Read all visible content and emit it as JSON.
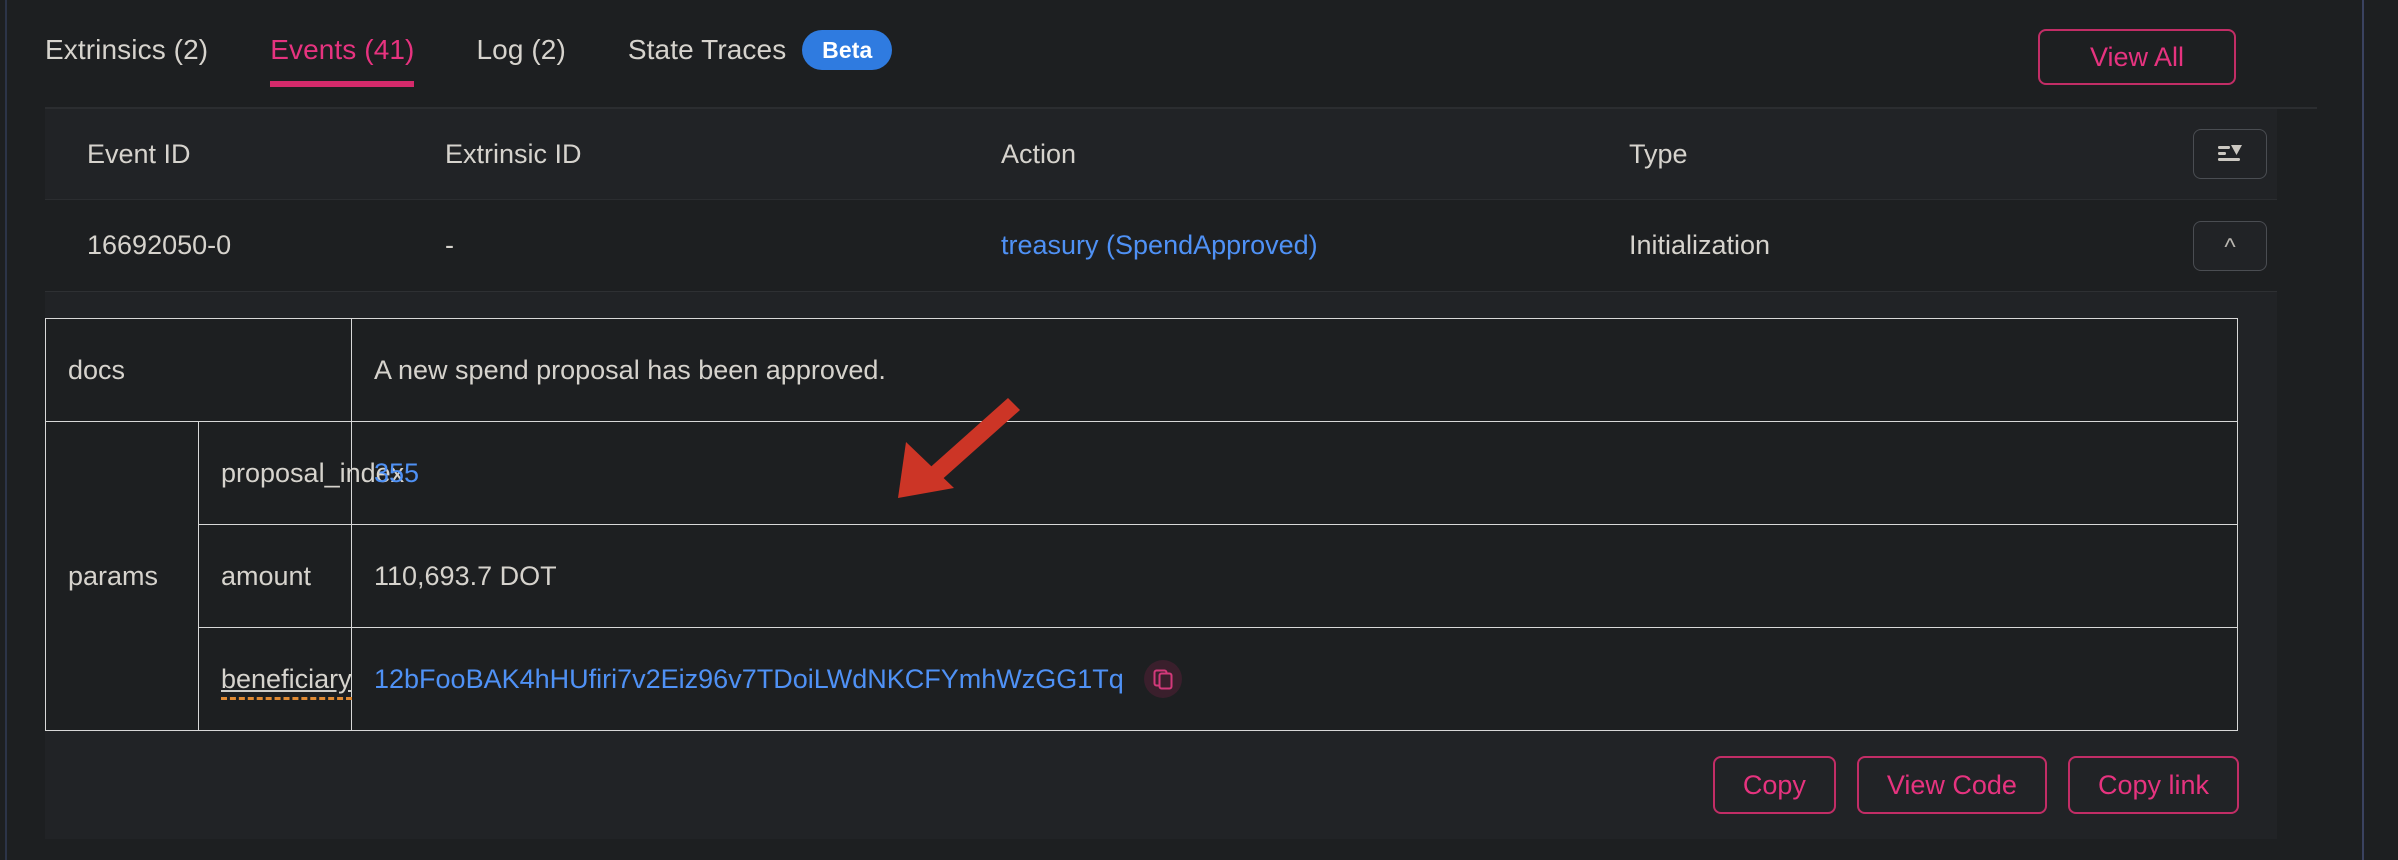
{
  "tabs": [
    {
      "label": "Extrinsics (2)",
      "active": false,
      "badge": null
    },
    {
      "label": "Events (41)",
      "active": true,
      "badge": null
    },
    {
      "label": "Log (2)",
      "active": false,
      "badge": null
    },
    {
      "label": "State Traces",
      "active": false,
      "badge": "Beta"
    }
  ],
  "header": {
    "view_all_label": "View All"
  },
  "table": {
    "columns": [
      "Event ID",
      "Extrinsic ID",
      "Action",
      "Type"
    ],
    "filter_icon": "sort-filter-icon",
    "rows": [
      {
        "event_id": "16692050-0",
        "extrinsic_id": "-",
        "action": "treasury (SpendApproved)",
        "type": "Initialization",
        "expand_icon": "chevron-up-icon"
      }
    ]
  },
  "detail": {
    "docs_key": "docs",
    "docs_value": "A new spend proposal has been approved.",
    "params_key": "params",
    "params": [
      {
        "name": "proposal_index",
        "value": "355",
        "is_link": true
      },
      {
        "name": "amount",
        "value": "110,693.7 DOT",
        "is_link": false
      },
      {
        "name": "beneficiary",
        "value": "12bFooBAK4hHUfiri7v2Eiz96v7TDoiLWdNKCFYmhWzGG1Tq",
        "is_link": true
      }
    ],
    "copy_icon": "copy-icon",
    "actions": [
      {
        "label": "Copy"
      },
      {
        "label": "View Code"
      },
      {
        "label": "Copy link"
      }
    ]
  },
  "colors": {
    "accent_pink": "#e6337f",
    "link_blue": "#4f91f5",
    "badge_blue": "#2f7be0",
    "annotation_red": "#cc3526",
    "spellcheck_orange": "#e08a33",
    "background": "#1d1f21",
    "panel": "#212326"
  }
}
